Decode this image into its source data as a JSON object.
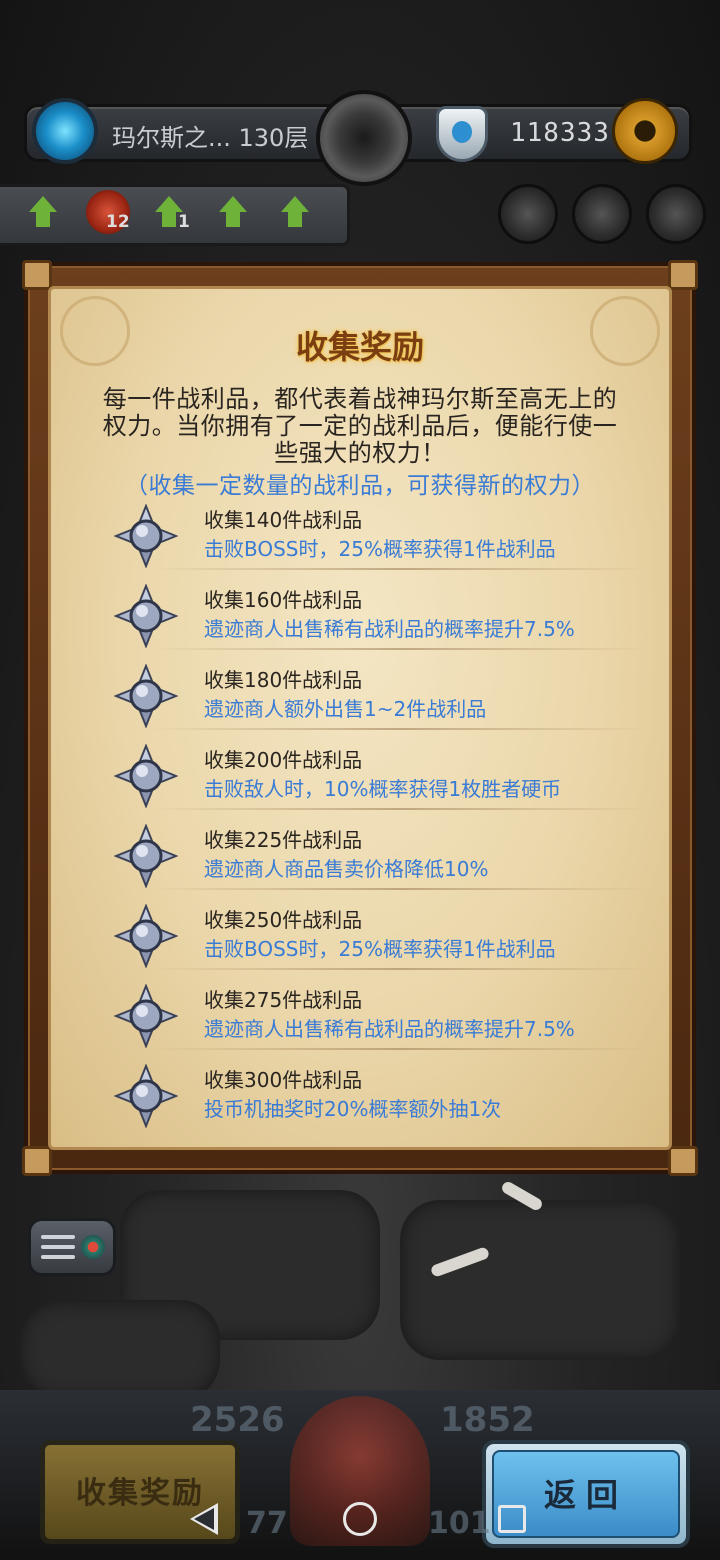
{
  "hud": {
    "floor": "玛尔斯之... 130层",
    "gold": "118333"
  },
  "buffs": [
    {
      "icon": "arrow-up-icon"
    },
    {
      "icon": "dragon-icon",
      "count": "12"
    },
    {
      "icon": "arrow-up-icon",
      "count": "1"
    },
    {
      "icon": "arrow-up-icon"
    },
    {
      "icon": "arrow-up-icon"
    }
  ],
  "panel": {
    "title": "收集奖励",
    "intro": "每一件战利品，都代表着战神玛尔斯至高无上的权力。当你拥有了一定的战利品后，便能行使一些强大的权力！",
    "hint": "（收集一定数量的战利品，可获得新的权力）",
    "rewards": [
      {
        "name": "收集140件战利品",
        "desc": "击败BOSS时，25%概率获得1件战利品"
      },
      {
        "name": "收集160件战利品",
        "desc": "遗迹商人出售稀有战利品的概率提升7.5%"
      },
      {
        "name": "收集180件战利品",
        "desc": "遗迹商人额外出售1~2件战利品"
      },
      {
        "name": "收集200件战利品",
        "desc": "击败敌人时，10%概率获得1枚胜者硬币"
      },
      {
        "name": "收集225件战利品",
        "desc": "遗迹商人商品售卖价格降低10%"
      },
      {
        "name": "收集250件战利品",
        "desc": "击败BOSS时，25%概率获得1件战利品"
      },
      {
        "name": "收集275件战利品",
        "desc": "遗迹商人出售稀有战利品的概率提升7.5%"
      },
      {
        "name": "收集300件战利品",
        "desc": "投币机抽奖时20%概率额外抽1次"
      }
    ]
  },
  "bottom": {
    "collect_label": "收集奖励",
    "return_label": "返回",
    "stat_left": "2526",
    "stat_right": "1852",
    "stat_bottom_left": "77",
    "stat_bottom_right": "101"
  },
  "colors": {
    "accent_blue": "#3a7bd5",
    "title_brown": "#7b3e10",
    "parchment": "#ead6a9"
  }
}
